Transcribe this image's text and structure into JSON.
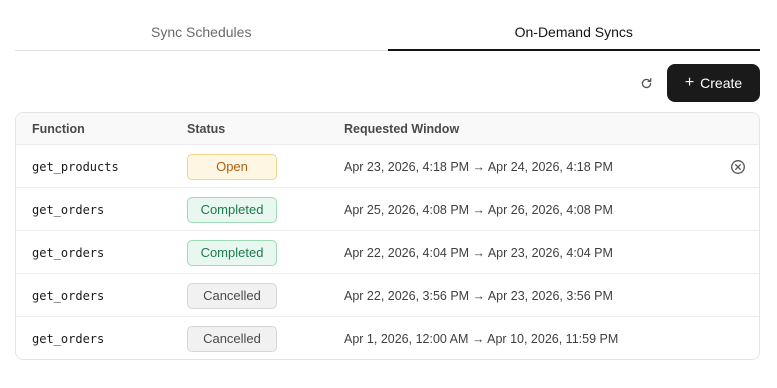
{
  "tabs": [
    {
      "label": "Sync Schedules",
      "active": false
    },
    {
      "label": "On-Demand Syncs",
      "active": true
    }
  ],
  "toolbar": {
    "refresh_icon": "refresh-icon",
    "create_label": "Create",
    "create_icon": "+"
  },
  "table": {
    "headers": {
      "function": "Function",
      "status": "Status",
      "window": "Requested Window"
    },
    "rows": [
      {
        "function": "get_products",
        "status": "Open",
        "window": "Apr 23, 2026, 4:18 PM → Apr 24, 2026, 4:18 PM",
        "cancel_icon": "cancel-circle-icon"
      },
      {
        "function": "get_orders",
        "status": "Completed",
        "window": "Apr 25, 2026, 4:08 PM → Apr 26, 2026, 4:08 PM"
      },
      {
        "function": "get_orders",
        "status": "Completed",
        "window": "Apr 22, 2026, 4:04 PM → Apr 23, 2026, 4:04 PM"
      },
      {
        "function": "get_orders",
        "status": "Cancelled",
        "window": "Apr 22, 2026, 3:56 PM → Apr 23, 2026, 3:56 PM"
      },
      {
        "function": "get_orders",
        "status": "Cancelled",
        "window": "Apr 1, 2026, 12:00 AM → Apr 10, 2026, 11:59 PM"
      }
    ]
  },
  "colors": {
    "primary_button": "#1a1a1a",
    "status_open": "#b15f10",
    "status_completed": "#1c7a4b",
    "status_cancelled": "#4a4a4a"
  }
}
